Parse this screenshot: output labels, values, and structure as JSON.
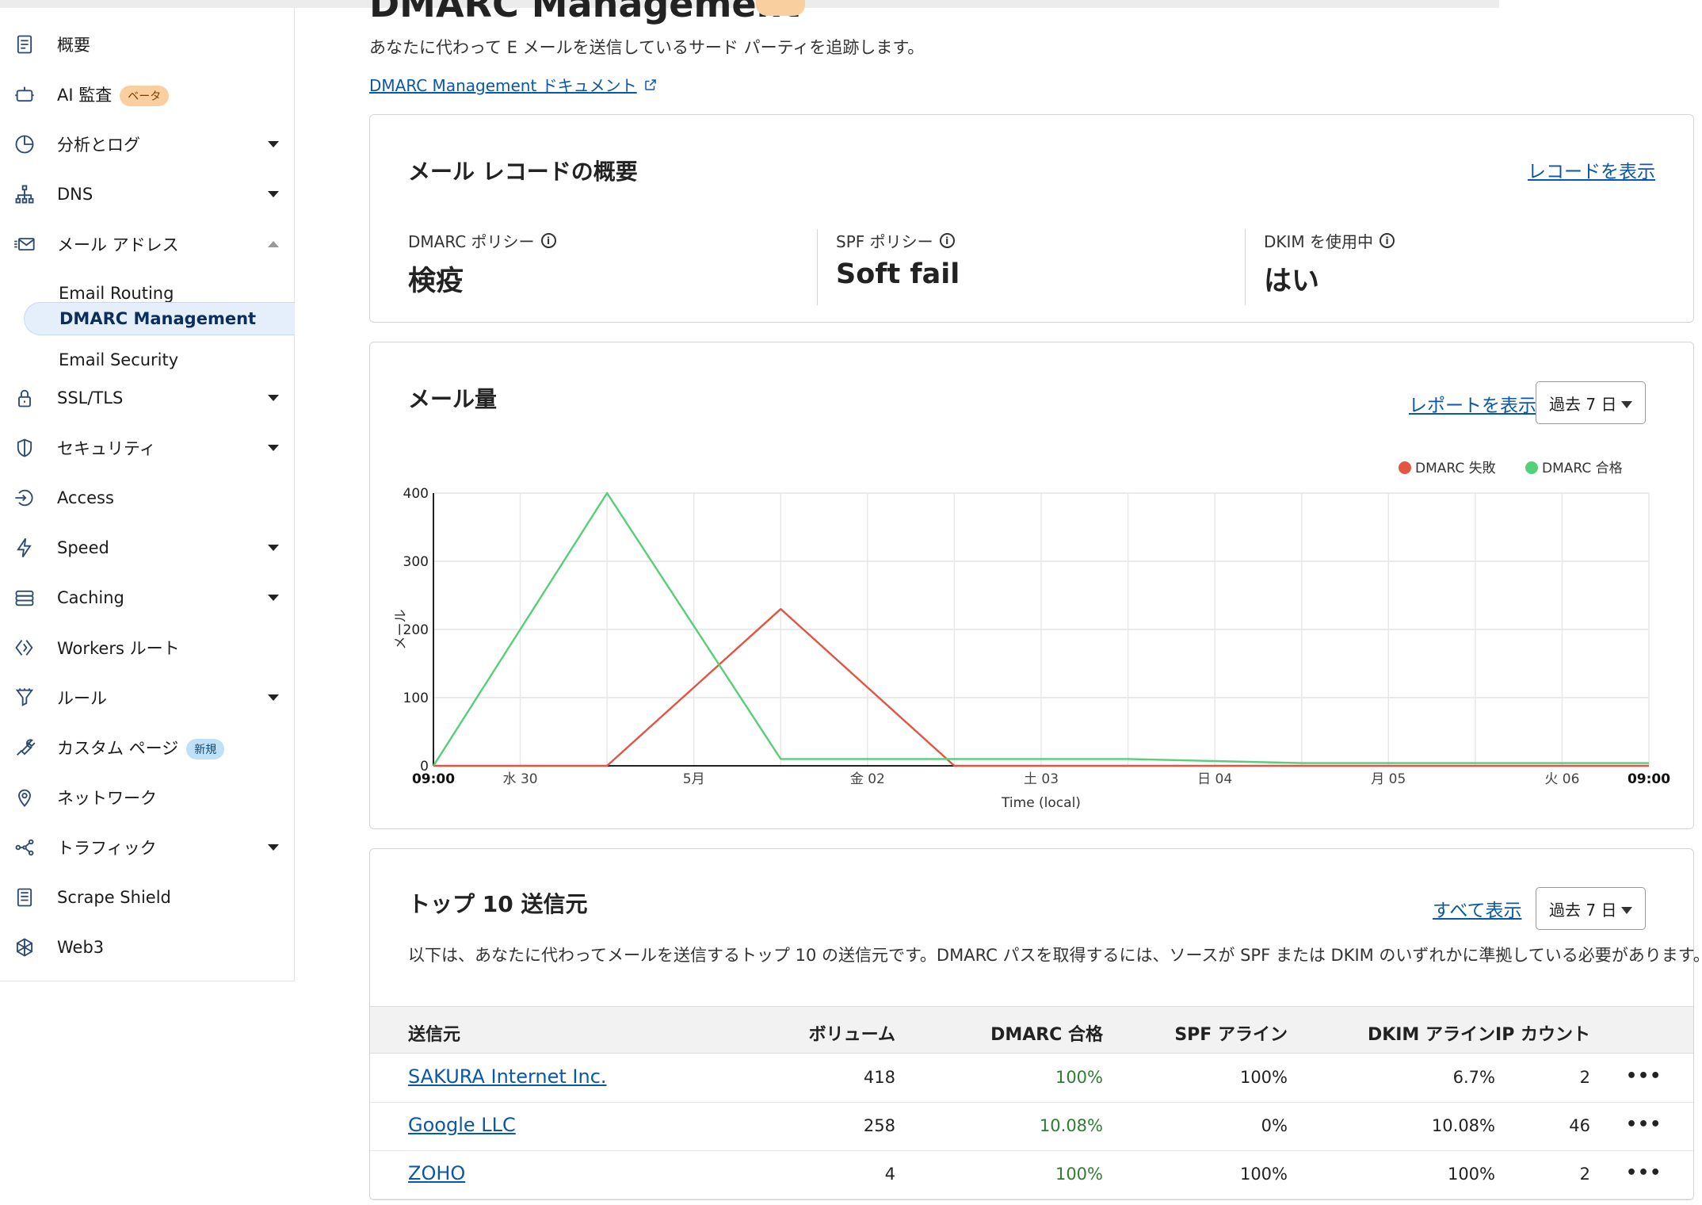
{
  "sidebar": {
    "items": [
      {
        "icon": "document-icon",
        "label": "概要"
      },
      {
        "icon": "robot-icon",
        "label": "AI 監査",
        "badge": "ベータ"
      },
      {
        "icon": "pie-chart-icon",
        "label": "分析とログ"
      },
      {
        "icon": "network-icon",
        "label": "DNS"
      },
      {
        "icon": "mail-icon",
        "label": "メール アドレス"
      },
      {
        "icon": "lock-icon",
        "label": "SSL/TLS"
      },
      {
        "icon": "shield-icon",
        "label": "セキュリティ"
      },
      {
        "icon": "access-icon",
        "label": "Access"
      },
      {
        "icon": "lightning-icon",
        "label": "Speed"
      },
      {
        "icon": "database-icon",
        "label": "Caching"
      },
      {
        "icon": "workers-icon",
        "label": "Workers ルート"
      },
      {
        "icon": "filter-icon",
        "label": "ルール"
      },
      {
        "icon": "wrench-icon",
        "label": "カスタム ページ",
        "badge": "新規"
      },
      {
        "icon": "location-pin-icon",
        "label": "ネットワーク"
      },
      {
        "icon": "traffic-icon",
        "label": "トラフィック"
      },
      {
        "icon": "page-icon",
        "label": "Scrape Shield"
      },
      {
        "icon": "web3-icon",
        "label": "Web3"
      }
    ],
    "email_subitems": [
      "Email Routing",
      "DMARC Management",
      "Email Security"
    ]
  },
  "page": {
    "title": "DMARC Management",
    "subtitle": "あなたに代わって E メールを送信しているサード パーティを追跡します。",
    "doc_link": "DMARC Management ドキュメント"
  },
  "records": {
    "title": "メール レコードの概要",
    "view_link": "レコードを表示",
    "stats": [
      {
        "label": "DMARC ポリシー",
        "value": "検疫"
      },
      {
        "label": "SPF ポリシー",
        "value": "Soft fail"
      },
      {
        "label": "DKIM を使用中",
        "value": "はい"
      }
    ]
  },
  "volume": {
    "title": "メール量",
    "report_link": "レポートを表示",
    "range_select": "過去 7 日"
  },
  "chart_data": {
    "type": "line",
    "x": [
      "09:00",
      "水 30",
      "",
      "5月",
      "",
      "金 02",
      "",
      "土 03",
      "",
      "日 04",
      "",
      "月 05",
      "",
      "火 06",
      "09:00"
    ],
    "x_tick_labels": [
      "09:00",
      "水 30",
      "5月",
      "金 02",
      "土 03",
      "日 04",
      "月 05",
      "火 06",
      "09:00"
    ],
    "series": [
      {
        "name": "DMARC 失敗",
        "color": "#e35445",
        "values": [
          0,
          0,
          0,
          115,
          230,
          115,
          0,
          0,
          0,
          0,
          0,
          0,
          0,
          0,
          0
        ]
      },
      {
        "name": "DMARC 合格",
        "color": "#55cf78",
        "values": [
          0,
          200,
          400,
          205,
          10,
          10,
          10,
          10,
          10,
          7,
          4,
          4,
          4,
          4,
          4
        ]
      }
    ],
    "xlabel": "Time (local)",
    "ylabel": "メール",
    "ylim": [
      0,
      400
    ],
    "y_ticks": [
      0,
      100,
      200,
      300,
      400
    ],
    "grid": true,
    "legend": "top-right"
  },
  "senders": {
    "title": "トップ 10 送信元",
    "view_all": "すべて表示",
    "range_select": "過去 7 日",
    "description": "以下は、あなたに代わってメールを送信するトップ 10 の送信元です。DMARC パスを取得するには、ソースが SPF または DKIM のいずれかに準拠している必要があります。",
    "columns": [
      "送信元",
      "ボリューム",
      "DMARC 合格",
      "SPF アライン",
      "DKIM アライン",
      "IP カウント"
    ],
    "rows": [
      {
        "name": "SAKURA Internet Inc.",
        "volume": "418",
        "dmarc": "100%",
        "spf": "100%",
        "dkim": "6.7%",
        "ip": "2"
      },
      {
        "name": "Google LLC",
        "volume": "258",
        "dmarc": "10.08%",
        "spf": "0%",
        "dkim": "10.08%",
        "ip": "46"
      },
      {
        "name": "ZOHO",
        "volume": "4",
        "dmarc": "100%",
        "spf": "100%",
        "dkim": "100%",
        "ip": "2"
      }
    ],
    "menu_glyph": "•••"
  }
}
